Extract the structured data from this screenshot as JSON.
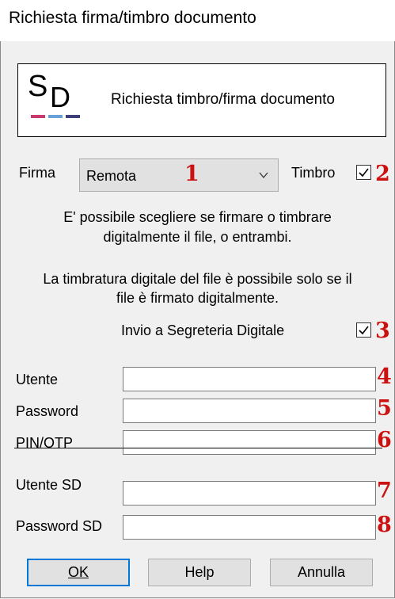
{
  "window": {
    "title": "Richiesta firma/timbro documento"
  },
  "header": {
    "logo_text": "SD",
    "title": "Richiesta timbro/firma documento"
  },
  "firma": {
    "label": "Firma",
    "selected": "Remota"
  },
  "timbro": {
    "label": "Timbro",
    "checked": true
  },
  "info": {
    "line1": "E' possibile scegliere se firmare o timbrare",
    "line2": "digitalmente il file, o entrambi.",
    "line3": "La timbratura digitale del file è possibile solo se il",
    "line4": "file è firmato digitalmente."
  },
  "invio": {
    "label": "Invio a Segreteria Digitale",
    "checked": true
  },
  "fields": {
    "utente": {
      "label": "Utente",
      "value": ""
    },
    "password": {
      "label": "Password",
      "value": ""
    },
    "pin": {
      "label": "PIN/OTP",
      "value": ""
    },
    "utente_sd": {
      "label": "Utente SD",
      "value": ""
    },
    "password_sd": {
      "label": "Password SD",
      "value": ""
    }
  },
  "markers": [
    "1",
    "2",
    "3",
    "4",
    "5",
    "6",
    "7",
    "8"
  ],
  "buttons": {
    "ok": "OK",
    "help": "Help",
    "annulla": "Annulla"
  },
  "colors": {
    "marker": "#cc1111",
    "focus": "#0078d7",
    "logo_stripes": [
      "#c83a6e",
      "#6aa0d8",
      "#3a3f7a"
    ]
  }
}
